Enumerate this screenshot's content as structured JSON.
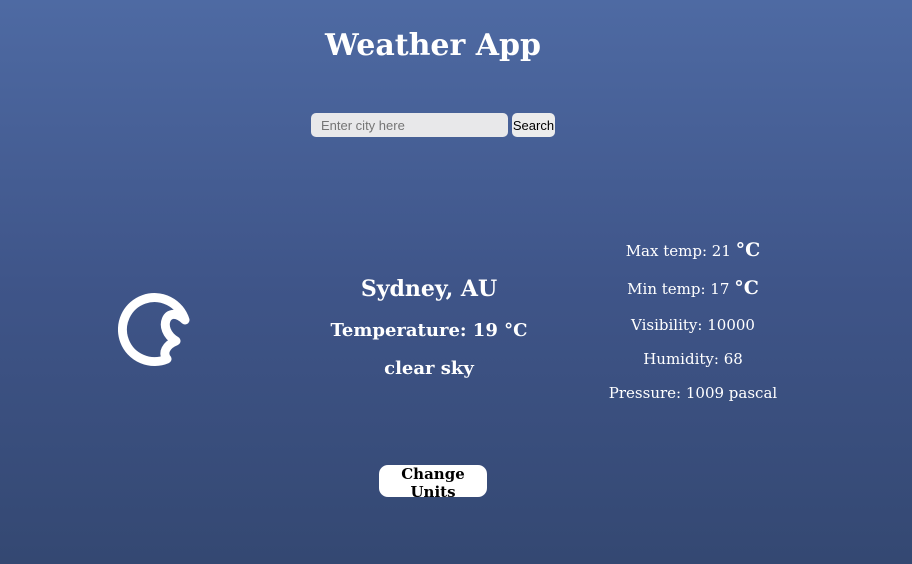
{
  "app": {
    "title": "Weather App"
  },
  "search": {
    "placeholder": "Enter city here",
    "value": "",
    "button_label": "Search"
  },
  "weather": {
    "icon": "moon-icon",
    "city": "Sydney, AU",
    "temperature_label": "Temperature: 19 °C",
    "description": "clear sky"
  },
  "details": {
    "max_temp_label": "Max temp: 21",
    "max_temp_unit": "°C",
    "min_temp_label": "Min temp: 17",
    "min_temp_unit": "°C",
    "visibility": "Visibility: 10000",
    "humidity": "Humidity: 68",
    "pressure": "Pressure: 1009 pascal"
  },
  "controls": {
    "change_units_label": "Change Units"
  }
}
